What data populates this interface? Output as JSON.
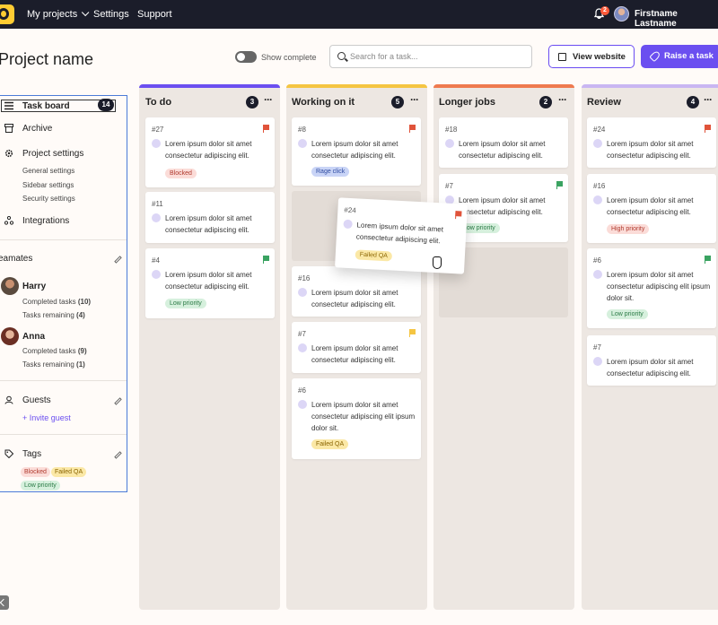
{
  "nav": {
    "items": [
      "My projects",
      "Settings",
      "Support"
    ],
    "notification_count": "2",
    "user_name": "Firstname Lastname"
  },
  "header": {
    "title": "Project name",
    "show_complete_label": "Show complete",
    "search_placeholder": "Search for a task...",
    "view_website_label": "View website",
    "raise_task_label": "Raise a task"
  },
  "sidebar": {
    "task_board": {
      "label": "Task board",
      "count": "14"
    },
    "archive": "Archive",
    "project_settings": "Project settings",
    "sub_settings": [
      "General settings",
      "Sidebar settings",
      "Security settings"
    ],
    "integrations": "Integrations",
    "teamates_label": "Teamates",
    "teammates": [
      {
        "name": "Harry",
        "completed_label": "Completed tasks",
        "completed": "(10)",
        "remaining_label": "Tasks remaining",
        "remaining": "(4)"
      },
      {
        "name": "Anna",
        "completed_label": "Completed tasks",
        "completed": "(9)",
        "remaining_label": "Tasks remaining",
        "remaining": "(1)"
      }
    ],
    "guests_label": "Guests",
    "invite_guest": "+ Invite guest",
    "tags_label": "Tags",
    "tags": [
      "Blocked",
      "Failed QA",
      "Low priority"
    ]
  },
  "colors": {
    "accent": "#6b4ff0",
    "todo": "#6b4ff0",
    "working": "#f5c542",
    "longer": "#ef7a4f",
    "review": "#c9b6f2",
    "flag_red": "#e0533a",
    "flag_green": "#3aa361",
    "flag_yellow": "#f5c542"
  },
  "columns": [
    {
      "title": "To do",
      "count": "3"
    },
    {
      "title": "Working on it",
      "count": "5"
    },
    {
      "title": "Longer jobs",
      "count": "2"
    },
    {
      "title": "Review",
      "count": "4"
    }
  ],
  "cards": {
    "todo": [
      {
        "id": "#27",
        "text": "Lorem ipsum dolor sit amet consectetur adipiscing elit.",
        "tag": "Blocked"
      },
      {
        "id": "#11",
        "text": "Lorem ipsum dolor sit amet consectetur adipiscing elit."
      },
      {
        "id": "#4",
        "text": "Lorem ipsum dolor sit amet consectetur adipiscing elit.",
        "tag": "Low priority"
      }
    ],
    "working": [
      {
        "id": "#8",
        "text": "Lorem ipsum dolor sit amet consectetur adipiscing elit.",
        "tag": "Rage click"
      },
      {
        "id": "#16",
        "text": "Lorem ipsum dolor sit amet consectetur adipiscing elit."
      },
      {
        "id": "#7",
        "text": "Lorem ipsum dolor sit amet consectetur adipiscing elit."
      },
      {
        "id": "#6",
        "text": "Lorem ipsum dolor sit amet consectetur adipiscing elit ipsum dolor sit.",
        "tag": "Failed QA"
      }
    ],
    "dragging": {
      "id": "#24",
      "text": "Lorem ipsum dolor sit amet consectetur adipiscing elit.",
      "tag": "Failed QA"
    },
    "longer": [
      {
        "id": "#18",
        "text": "Lorem ipsum dolor sit amet consectetur adipiscing elit."
      },
      {
        "id": "#7",
        "text": "Lorem ipsum dolor sit amet consectetur adipiscing elit.",
        "tag": "Low priority"
      }
    ],
    "review": [
      {
        "id": "#24",
        "text": "Lorem ipsum dolor sit amet consectetur adipiscing elit."
      },
      {
        "id": "#16",
        "text": "Lorem ipsum dolor sit amet consectetur adipiscing elit.",
        "tag": "High priority"
      },
      {
        "id": "#6",
        "text": "Lorem ipsum dolor sit amet consectetur adipiscing elit ipsum dolor sit.",
        "tag": "Low priority"
      },
      {
        "id": "#7",
        "text": "Lorem ipsum dolor sit amet consectetur adipiscing elit."
      }
    ]
  }
}
